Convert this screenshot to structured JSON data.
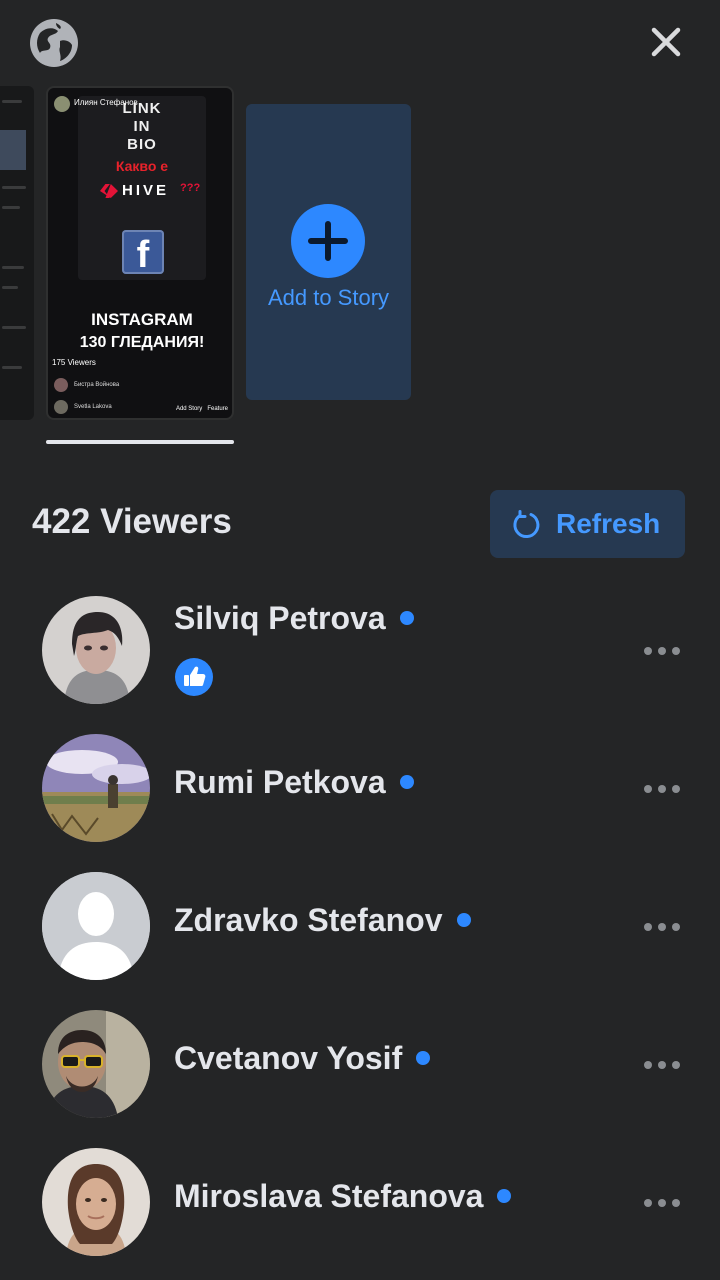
{
  "header": {
    "globe_icon": "globe-icon",
    "close_icon": "close-icon"
  },
  "story_preview": {
    "poster_name": "Илиян Стефанов",
    "line1": "LINK",
    "line2": "IN",
    "line3": "BIO",
    "kakvo": "Какво е",
    "hive": "HIVE",
    "hive_q": "???",
    "instagram": "INSTAGRAM",
    "views_text": "130 ГЛЕДАНИЯ!",
    "viewers_small": "175 Viewers",
    "row1_name": "Бистра Войнова",
    "row2_name": "Svetla Lakova",
    "add_story_small": "Add Story",
    "feature_small": "Feature"
  },
  "add_story": {
    "label": "Add to Story"
  },
  "viewers": {
    "count_label": "422 Viewers",
    "refresh_label": "Refresh",
    "accent": "#2d88ff",
    "list": [
      {
        "name": "Silviq Petrova",
        "reaction": "like"
      },
      {
        "name": "Rumi Petkova"
      },
      {
        "name": "Zdravko Stefanov"
      },
      {
        "name": "Cvetanov Yosif"
      },
      {
        "name": "Miroslava Stefanova"
      }
    ]
  }
}
